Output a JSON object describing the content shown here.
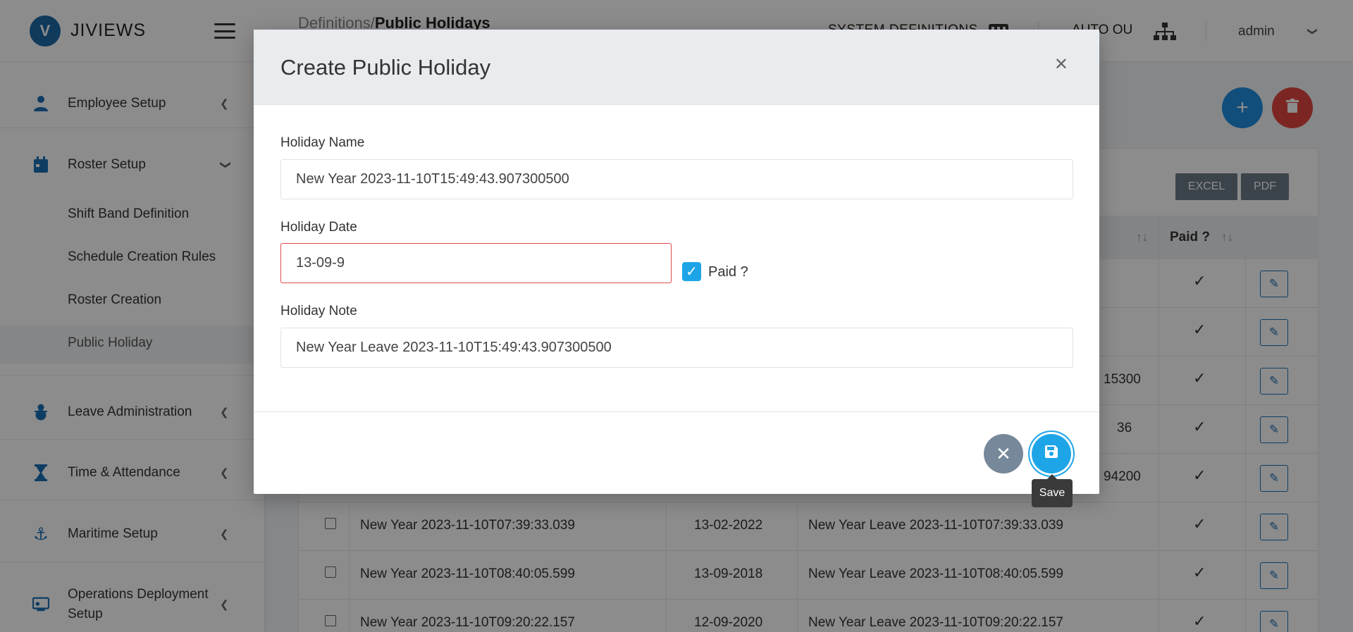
{
  "brand": {
    "name": "JIVIEWS",
    "logo_letter": "V"
  },
  "breadcrumb": {
    "parent": "Definitions/",
    "current": "Public Holidays"
  },
  "topbar": {
    "system_definitions": "SYSTEM DEFINITIONS",
    "auto_ou": "AUTO OU",
    "user": "admin"
  },
  "sidebar": {
    "employee_setup": "Employee Setup",
    "roster_setup": "Roster Setup",
    "roster_children": [
      "Shift Band Definition",
      "Schedule Creation Rules",
      "Roster Creation",
      "Public Holiday"
    ],
    "leave_admin": "Leave Administration",
    "time_attendance": "Time & Attendance",
    "maritime": "Maritime Setup",
    "operations_line1": "Operations Deployment",
    "operations_line2": "Setup"
  },
  "table": {
    "export_excel": "EXCEL",
    "export_pdf": "PDF",
    "header_paid": "Paid ?",
    "partial_suffixes": [
      "15300",
      "36",
      "94200"
    ],
    "rows": [
      {
        "name": "New Year 2023-11-10T07:39:33.039",
        "date": "13-02-2022",
        "note": "New Year Leave 2023-11-10T07:39:33.039"
      },
      {
        "name": "New Year 2023-11-10T08:40:05.599",
        "date": "13-09-2018",
        "note": "New Year Leave 2023-11-10T08:40:05.599"
      },
      {
        "name": "New Year 2023-11-10T09:20:22.157",
        "date": "12-09-2020",
        "note": "New Year Leave 2023-11-10T09:20:22.157"
      }
    ]
  },
  "modal": {
    "title": "Create Public Holiday",
    "holiday_name_label": "Holiday Name",
    "holiday_name_value": "New Year 2023-11-10T15:49:43.907300500",
    "holiday_date_label": "Holiday Date",
    "holiday_date_value": "13-09-9",
    "paid_label": "Paid ?",
    "paid_checked": true,
    "holiday_note_label": "Holiday Note",
    "holiday_note_value": "New Year Leave 2023-11-10T15:49:43.907300500",
    "save_tooltip": "Save"
  },
  "colors": {
    "primary": "#1ea5e8",
    "danger": "#e0453f",
    "error_border": "#e04a4a",
    "sidebar_icon": "#1a6fb5"
  }
}
